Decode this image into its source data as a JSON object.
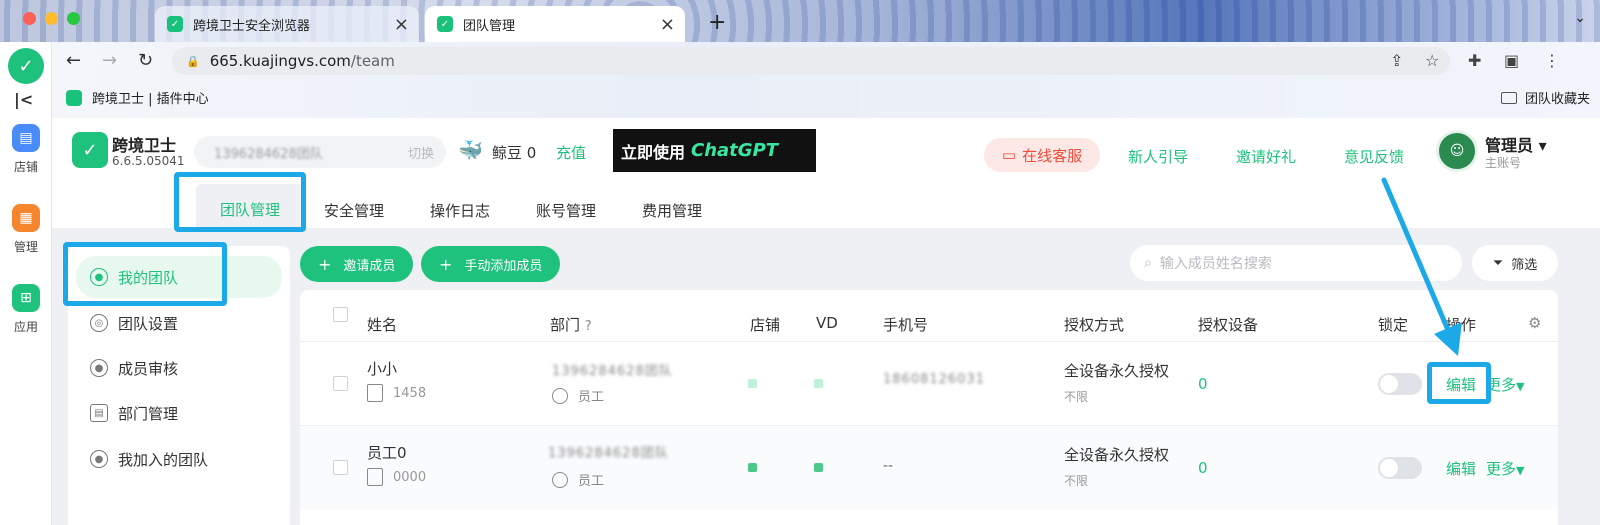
{
  "browser": {
    "tabs": [
      {
        "title": "跨境卫士安全浏览器"
      },
      {
        "title": "团队管理"
      }
    ],
    "new_tab": "+",
    "address": {
      "host": "665.kuajingvs.com",
      "path": "/team"
    },
    "bookmarks": [
      {
        "label": "跨境卫士 | 插件中心"
      },
      {
        "label": "团队收藏夹"
      }
    ]
  },
  "rail": {
    "items": [
      {
        "label": "店铺",
        "color": "#4a8cf7"
      },
      {
        "label": "管理",
        "color": "#f5862e"
      },
      {
        "label": "应用",
        "color": "#1ec27d"
      }
    ]
  },
  "header": {
    "brand": "跨境卫士",
    "version": "6.6.5.05041",
    "team_switch_value": "1396284628团队",
    "team_switch_label": "切换",
    "beans_label": "鲸豆 0",
    "recharge": "充值",
    "promo_text": "立即使用",
    "promo_brand": "ChatGPT",
    "service": "在线客服",
    "links": [
      "新人引导",
      "邀请好礼",
      "意见反馈"
    ],
    "user_name": "管理员",
    "user_role": "主账号"
  },
  "main_tabs": [
    "团队管理",
    "安全管理",
    "操作日志",
    "账号管理",
    "费用管理"
  ],
  "side_menu": [
    "我的团队",
    "团队设置",
    "成员审核",
    "部门管理",
    "我加入的团队"
  ],
  "actions": {
    "invite": "邀请成员",
    "add_manual": "手动添加成员",
    "search_placeholder": "输入成员姓名搜索",
    "filter": "筛选"
  },
  "table": {
    "columns": [
      "姓名",
      "部门",
      "店铺",
      "VD",
      "手机号",
      "授权方式",
      "授权设备",
      "锁定",
      "操作"
    ],
    "rows": [
      {
        "name": "小小",
        "code": "1458",
        "dept": "1396284628团队",
        "role": "员工",
        "phone": "18608126031",
        "auth": "全设备永久授权",
        "auth_sub": "不限",
        "devices": "0",
        "edit": "编辑",
        "more": "更多"
      },
      {
        "name": "员工0",
        "code": "0000",
        "dept": "1396284628团队",
        "role": "员工",
        "phone": "--",
        "auth": "全设备永久授权",
        "auth_sub": "不限",
        "devices": "0",
        "edit": "编辑",
        "more": "更多"
      }
    ]
  },
  "colors": {
    "accent": "#1ec27d",
    "highlight": "#1da9e8",
    "service": "#f04b3a"
  }
}
